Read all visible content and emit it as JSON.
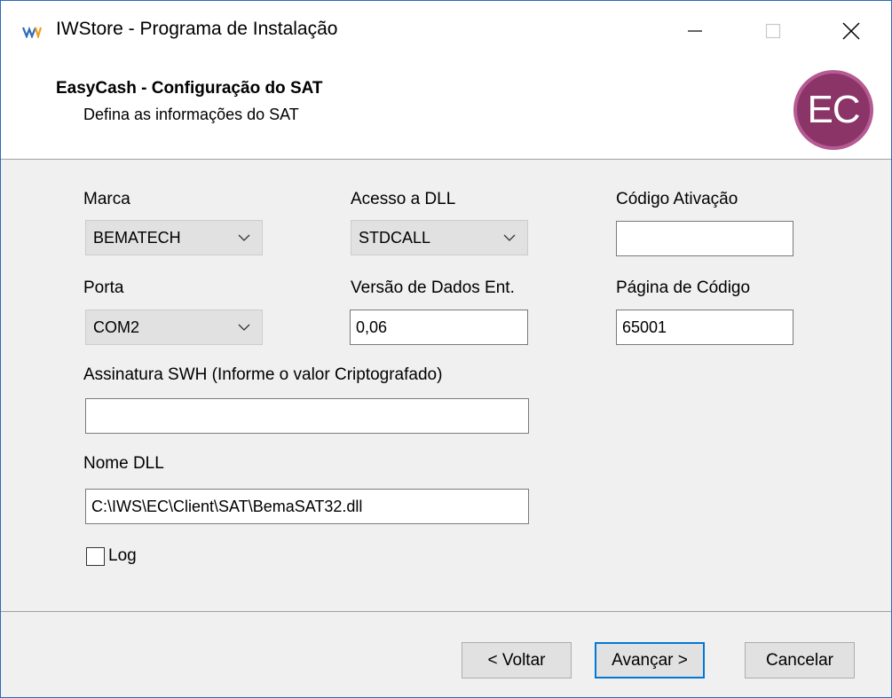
{
  "window": {
    "title": "IWStore - Programa de Instalação",
    "app_icon": "iw-logo-icon"
  },
  "titlebar_controls": {
    "minimize_icon": "minimize-icon",
    "maximize_icon": "maximize-icon",
    "close_icon": "close-icon"
  },
  "header": {
    "title": "EasyCash - Configuração do SAT",
    "subtitle": "Defina as informações do SAT",
    "logo_text": "EC",
    "logo_color": "#8a3468"
  },
  "form": {
    "marca": {
      "label": "Marca",
      "value": "BEMATECH"
    },
    "acesso_dll": {
      "label": "Acesso a DLL",
      "value": "STDCALL"
    },
    "codigo_ativacao": {
      "label": "Código Ativação",
      "value": ""
    },
    "porta": {
      "label": "Porta",
      "value": "COM2"
    },
    "versao_dados": {
      "label": "Versão de Dados Ent.",
      "value": "0,06"
    },
    "pagina_codigo": {
      "label": "Página de Código",
      "value": "65001"
    },
    "assinatura_swh": {
      "label": "Assinatura SWH (Informe o valor Criptografado)",
      "value": ""
    },
    "nome_dll": {
      "label": "Nome DLL",
      "value": "C:\\IWS\\EC\\Client\\SAT\\BemaSAT32.dll"
    },
    "log": {
      "label": "Log",
      "checked": false
    }
  },
  "buttons": {
    "back": "< Voltar",
    "next": "Avançar >",
    "cancel": "Cancelar"
  },
  "colors": {
    "accent": "#0078d7",
    "window_border": "#2b6cb8"
  }
}
